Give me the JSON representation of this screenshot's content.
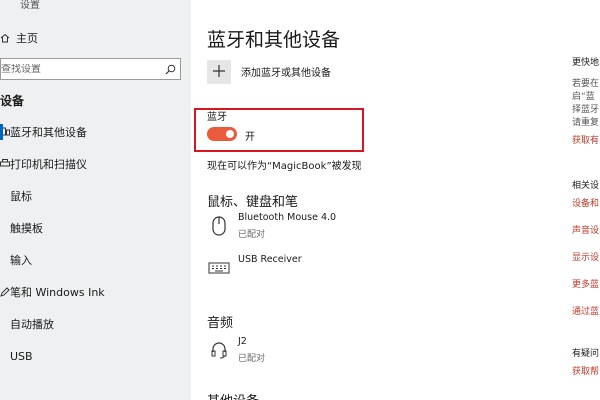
{
  "sidebar": {
    "title": "设置",
    "home": "主页",
    "search_placeholder": "查找设置",
    "section": "设备",
    "items": [
      {
        "label": "蓝牙和其他设备",
        "icon": "bluetooth-devices-icon",
        "active": true
      },
      {
        "label": "打印机和扫描仪",
        "icon": "printer-icon",
        "active": false
      },
      {
        "label": "鼠标",
        "icon": "mouse-icon",
        "active": false
      },
      {
        "label": "触摸板",
        "icon": "touchpad-icon",
        "active": false
      },
      {
        "label": "输入",
        "icon": "keyboard-icon",
        "active": false
      },
      {
        "label": "笔和 Windows Ink",
        "icon": "pen-icon",
        "active": false
      },
      {
        "label": "自动播放",
        "icon": "autoplay-icon",
        "active": false
      },
      {
        "label": "USB",
        "icon": "usb-icon",
        "active": false
      }
    ]
  },
  "main": {
    "title": "蓝牙和其他设备",
    "add_label": "添加蓝牙或其他设备",
    "bluetooth_label": "蓝牙",
    "bluetooth_state": "开",
    "bluetooth_on": true,
    "discoverable": "现在可以作为“MagicBook”被发现",
    "sections": {
      "mouse_keyboard_pen": "鼠标、键盘和笔",
      "audio": "音频",
      "other": "其他设备"
    },
    "devices": {
      "mouse": {
        "name": "Bluetooth Mouse 4.0",
        "status": "已配对"
      },
      "usb": {
        "name": "USB Receiver"
      },
      "j2": {
        "name": "J2",
        "status": "已配对"
      }
    }
  },
  "right": {
    "faster_heading": "更快地",
    "faster_lines": [
      "若要在",
      "启“蓝",
      "择蓝牙",
      "请重复"
    ],
    "faster_link": "获取有",
    "related_heading": "相关设",
    "related_links": [
      "设备和",
      "声音设",
      "显示设",
      "更多蓝",
      "通过蓝"
    ],
    "question_heading": "有疑问",
    "question_link": "获取帮"
  },
  "colors": {
    "accent": "#0067c0",
    "toggle_on": "#e95b3b",
    "highlight": "#d9161f",
    "link": "#c0392b"
  }
}
